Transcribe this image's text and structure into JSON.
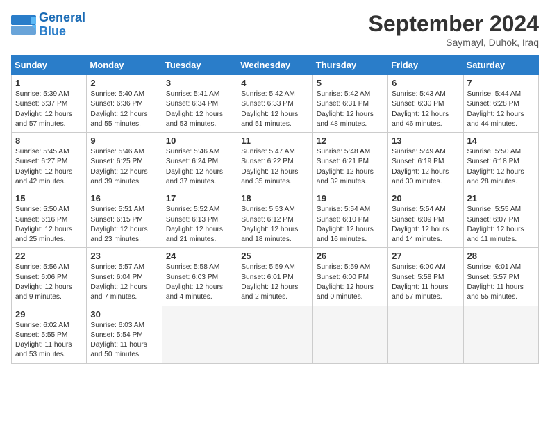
{
  "header": {
    "logo_line1": "General",
    "logo_line2": "Blue",
    "month_year": "September 2024",
    "location": "Saymayl, Duhok, Iraq"
  },
  "calendar": {
    "days_of_week": [
      "Sunday",
      "Monday",
      "Tuesday",
      "Wednesday",
      "Thursday",
      "Friday",
      "Saturday"
    ],
    "weeks": [
      [
        {
          "day": "",
          "empty": true
        },
        {
          "day": "",
          "empty": true
        },
        {
          "day": "",
          "empty": true
        },
        {
          "day": "",
          "empty": true
        },
        {
          "day": "",
          "empty": true
        },
        {
          "day": "",
          "empty": true
        },
        {
          "day": "",
          "empty": true
        }
      ],
      [
        {
          "day": "1",
          "info": "Sunrise: 5:39 AM\nSunset: 6:37 PM\nDaylight: 12 hours\nand 57 minutes."
        },
        {
          "day": "2",
          "info": "Sunrise: 5:40 AM\nSunset: 6:36 PM\nDaylight: 12 hours\nand 55 minutes."
        },
        {
          "day": "3",
          "info": "Sunrise: 5:41 AM\nSunset: 6:34 PM\nDaylight: 12 hours\nand 53 minutes."
        },
        {
          "day": "4",
          "info": "Sunrise: 5:42 AM\nSunset: 6:33 PM\nDaylight: 12 hours\nand 51 minutes."
        },
        {
          "day": "5",
          "info": "Sunrise: 5:42 AM\nSunset: 6:31 PM\nDaylight: 12 hours\nand 48 minutes."
        },
        {
          "day": "6",
          "info": "Sunrise: 5:43 AM\nSunset: 6:30 PM\nDaylight: 12 hours\nand 46 minutes."
        },
        {
          "day": "7",
          "info": "Sunrise: 5:44 AM\nSunset: 6:28 PM\nDaylight: 12 hours\nand 44 minutes."
        }
      ],
      [
        {
          "day": "8",
          "info": "Sunrise: 5:45 AM\nSunset: 6:27 PM\nDaylight: 12 hours\nand 42 minutes."
        },
        {
          "day": "9",
          "info": "Sunrise: 5:46 AM\nSunset: 6:25 PM\nDaylight: 12 hours\nand 39 minutes."
        },
        {
          "day": "10",
          "info": "Sunrise: 5:46 AM\nSunset: 6:24 PM\nDaylight: 12 hours\nand 37 minutes."
        },
        {
          "day": "11",
          "info": "Sunrise: 5:47 AM\nSunset: 6:22 PM\nDaylight: 12 hours\nand 35 minutes."
        },
        {
          "day": "12",
          "info": "Sunrise: 5:48 AM\nSunset: 6:21 PM\nDaylight: 12 hours\nand 32 minutes."
        },
        {
          "day": "13",
          "info": "Sunrise: 5:49 AM\nSunset: 6:19 PM\nDaylight: 12 hours\nand 30 minutes."
        },
        {
          "day": "14",
          "info": "Sunrise: 5:50 AM\nSunset: 6:18 PM\nDaylight: 12 hours\nand 28 minutes."
        }
      ],
      [
        {
          "day": "15",
          "info": "Sunrise: 5:50 AM\nSunset: 6:16 PM\nDaylight: 12 hours\nand 25 minutes."
        },
        {
          "day": "16",
          "info": "Sunrise: 5:51 AM\nSunset: 6:15 PM\nDaylight: 12 hours\nand 23 minutes."
        },
        {
          "day": "17",
          "info": "Sunrise: 5:52 AM\nSunset: 6:13 PM\nDaylight: 12 hours\nand 21 minutes."
        },
        {
          "day": "18",
          "info": "Sunrise: 5:53 AM\nSunset: 6:12 PM\nDaylight: 12 hours\nand 18 minutes."
        },
        {
          "day": "19",
          "info": "Sunrise: 5:54 AM\nSunset: 6:10 PM\nDaylight: 12 hours\nand 16 minutes."
        },
        {
          "day": "20",
          "info": "Sunrise: 5:54 AM\nSunset: 6:09 PM\nDaylight: 12 hours\nand 14 minutes."
        },
        {
          "day": "21",
          "info": "Sunrise: 5:55 AM\nSunset: 6:07 PM\nDaylight: 12 hours\nand 11 minutes."
        }
      ],
      [
        {
          "day": "22",
          "info": "Sunrise: 5:56 AM\nSunset: 6:06 PM\nDaylight: 12 hours\nand 9 minutes."
        },
        {
          "day": "23",
          "info": "Sunrise: 5:57 AM\nSunset: 6:04 PM\nDaylight: 12 hours\nand 7 minutes."
        },
        {
          "day": "24",
          "info": "Sunrise: 5:58 AM\nSunset: 6:03 PM\nDaylight: 12 hours\nand 4 minutes."
        },
        {
          "day": "25",
          "info": "Sunrise: 5:59 AM\nSunset: 6:01 PM\nDaylight: 12 hours\nand 2 minutes."
        },
        {
          "day": "26",
          "info": "Sunrise: 5:59 AM\nSunset: 6:00 PM\nDaylight: 12 hours\nand 0 minutes."
        },
        {
          "day": "27",
          "info": "Sunrise: 6:00 AM\nSunset: 5:58 PM\nDaylight: 11 hours\nand 57 minutes."
        },
        {
          "day": "28",
          "info": "Sunrise: 6:01 AM\nSunset: 5:57 PM\nDaylight: 11 hours\nand 55 minutes."
        }
      ],
      [
        {
          "day": "29",
          "info": "Sunrise: 6:02 AM\nSunset: 5:55 PM\nDaylight: 11 hours\nand 53 minutes."
        },
        {
          "day": "30",
          "info": "Sunrise: 6:03 AM\nSunset: 5:54 PM\nDaylight: 11 hours\nand 50 minutes."
        },
        {
          "day": "",
          "empty": true
        },
        {
          "day": "",
          "empty": true
        },
        {
          "day": "",
          "empty": true
        },
        {
          "day": "",
          "empty": true
        },
        {
          "day": "",
          "empty": true
        }
      ]
    ]
  }
}
